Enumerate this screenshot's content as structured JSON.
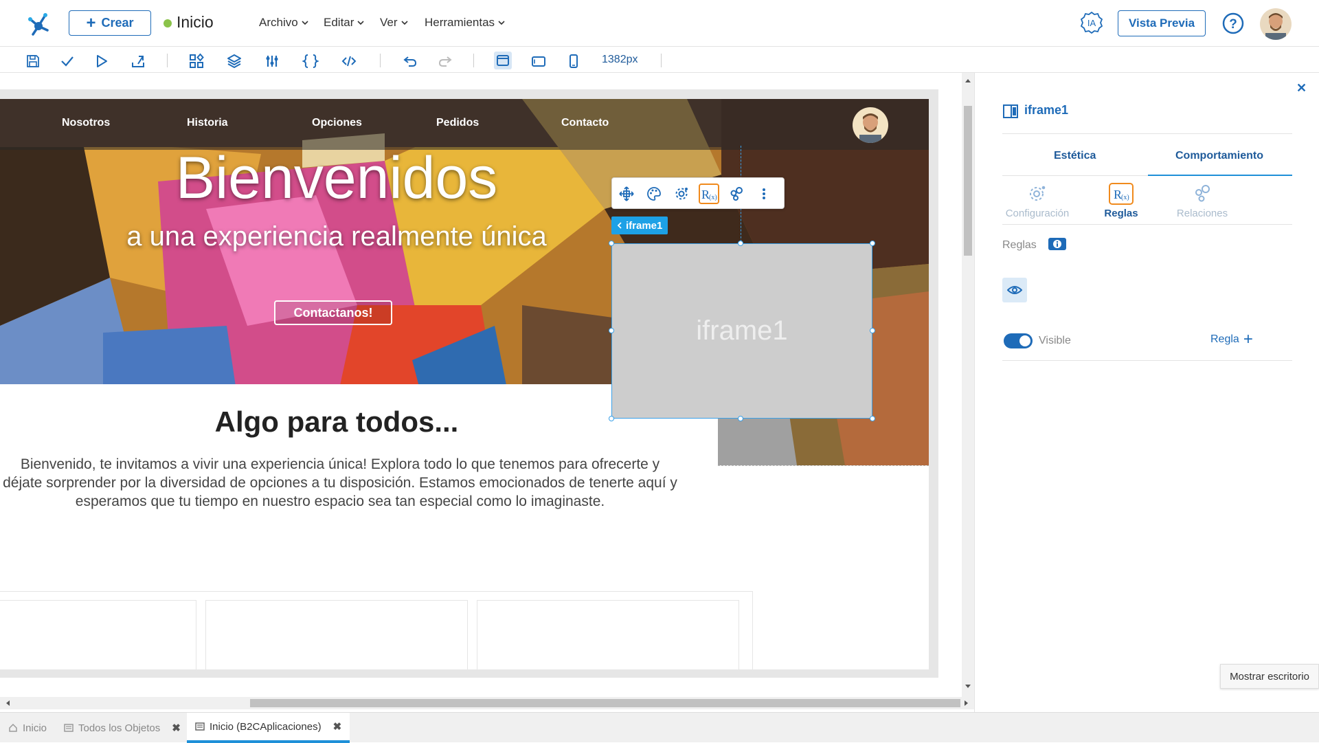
{
  "topbar": {
    "create_label": "Crear",
    "page_title": "Inicio",
    "menus": [
      "Archivo",
      "Editar",
      "Ver",
      "Herramientas"
    ],
    "ai_label": "IA",
    "preview_label": "Vista Previa",
    "status_color": "#8bc34a",
    "accent": "#1e6bb8"
  },
  "toolbar": {
    "icons": [
      "save-icon",
      "check-icon",
      "play-icon",
      "publish-icon",
      "components-icon",
      "layers-icon",
      "variables-icon",
      "braces-icon",
      "code-icon",
      "undo-icon",
      "redo-icon",
      "desktop-view-icon",
      "tablet-view-icon",
      "mobile-view-icon"
    ],
    "width_readout": "1382px"
  },
  "site": {
    "nav": [
      "Nosotros",
      "Historia",
      "Opciones",
      "Pedidos",
      "Contacto"
    ],
    "hero_title": "Bienvenidos",
    "hero_subtitle": "a una experiencia realmente única",
    "hero_cta": "Contactanos!",
    "content_heading": "Algo para todos...",
    "content_body": "Bienvenido, te invitamos a vivir una experiencia única! Explora todo lo que tenemos para ofrecerte y déjate sorprender por la diversidad de opciones a tu disposición. Estamos emocionados de tenerte aquí y esperamos que tu tiempo en nuestro espacio sea tan especial como lo imaginaste."
  },
  "component": {
    "tag": "iframe1",
    "placeholder": "iframe1",
    "toolbar_icons": [
      "move-icon",
      "palette-icon",
      "settings-icon",
      "rules-icon",
      "relations-icon",
      "more-icon"
    ]
  },
  "panel": {
    "title": "iframe1",
    "tabs": [
      "Estética",
      "Comportamiento"
    ],
    "subtabs": [
      "Configuración",
      "Reglas",
      "Relaciones"
    ],
    "rules_label": "Reglas",
    "visible_label": "Visible",
    "visible_on": true,
    "rule_add_label": "Regla"
  },
  "tooltip": "Mostrar escritorio",
  "bottom_tabs": [
    {
      "label": "Inicio",
      "icon": "home-icon"
    },
    {
      "label": "Todos los Objetos",
      "icon": "list-icon"
    },
    {
      "label": "Inicio (B2CAplicaciones)",
      "icon": "page-icon"
    }
  ]
}
